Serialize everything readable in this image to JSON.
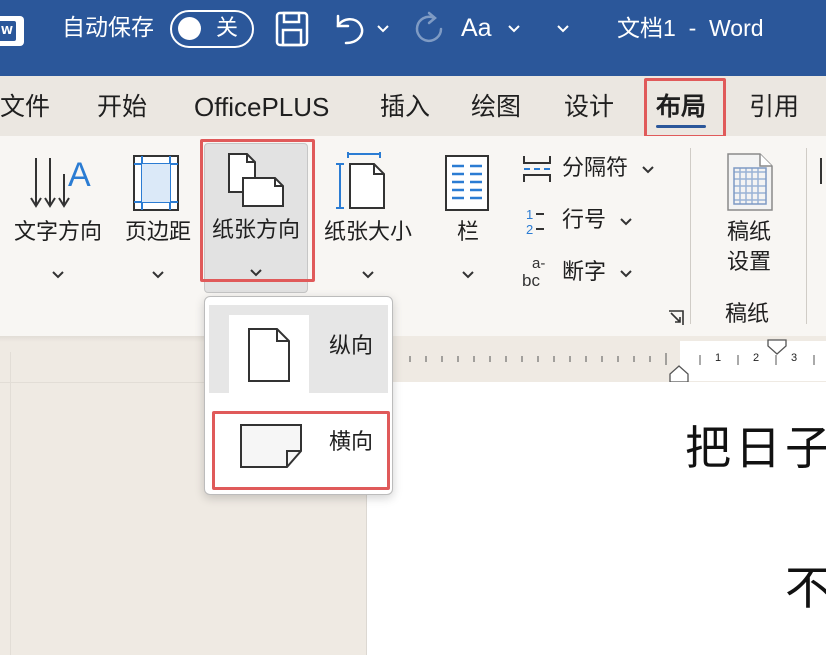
{
  "titlebar": {
    "app_icon": "word-app-icon",
    "autosave_label": "自动保存",
    "autosave_state": "关",
    "font_case_label": "Aa",
    "doc_title": "文档1  -  Word",
    "icons": [
      "save-icon",
      "undo-icon",
      "chevron-down-icon",
      "redo-icon",
      "chevron-down-icon"
    ]
  },
  "tabs": [
    {
      "label": "文件"
    },
    {
      "label": "开始"
    },
    {
      "label": "OfficePLUS"
    },
    {
      "label": "插入"
    },
    {
      "label": "绘图"
    },
    {
      "label": "设计"
    },
    {
      "label": "布局",
      "active": true
    },
    {
      "label": "引用"
    }
  ],
  "ribbon": {
    "text_direction": "文字方向",
    "margins": "页边距",
    "orientation": "纸张方向",
    "size": "纸张大小",
    "columns": "栏",
    "breaks": "分隔符",
    "line_numbers": "行号",
    "hyphenation": "断字",
    "grid_paper_setup_line1": "稿纸",
    "grid_paper_setup_line2": "设置",
    "group_grid_paper": "稿纸"
  },
  "orientation_menu": {
    "portrait": "纵向",
    "landscape": "横向"
  },
  "ruler": {
    "numbers": [
      "1",
      "2",
      "3"
    ]
  },
  "document": {
    "line1": "把日子",
    "line2": "不"
  },
  "colors": {
    "titlebar_bg": "#2b579a",
    "accent_highlight": "#e05a5a",
    "tab_underline": "#2b579a"
  }
}
